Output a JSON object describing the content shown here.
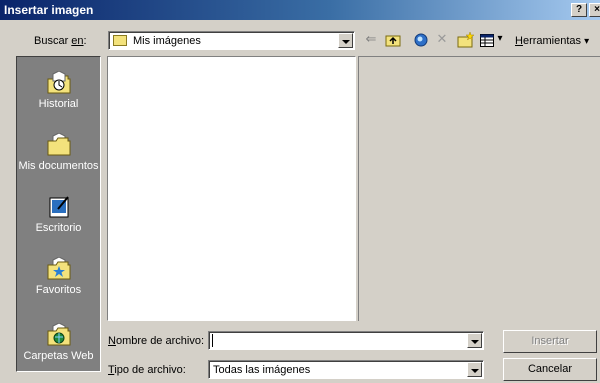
{
  "window": {
    "title": "Insertar imagen",
    "help_label": "?",
    "close_label": "×"
  },
  "lookin": {
    "label_pre": "Buscar ",
    "label_ul": "en",
    "label_post": ":",
    "value": "Mis imágenes"
  },
  "toolbar": {
    "tools_label_ul": "H",
    "tools_label_rest": "erramientas",
    "tools_arrow": "▾",
    "views_arrow": "▾"
  },
  "places": [
    {
      "label": "Historial",
      "icon": "history-icon"
    },
    {
      "label": "Mis documentos",
      "icon": "my-documents-icon"
    },
    {
      "label": "Escritorio",
      "icon": "desktop-icon"
    },
    {
      "label": "Favoritos",
      "icon": "favorites-icon"
    },
    {
      "label": "Carpetas Web",
      "icon": "web-folders-icon"
    }
  ],
  "filename": {
    "label_ul": "N",
    "label_rest": "ombre de archivo:",
    "value": ""
  },
  "filetype": {
    "label_ul": "T",
    "label_rest": "ipo de archivo:",
    "value": "Todas las imágenes"
  },
  "buttons": {
    "insert": "Insertar",
    "cancel": "Cancelar"
  }
}
